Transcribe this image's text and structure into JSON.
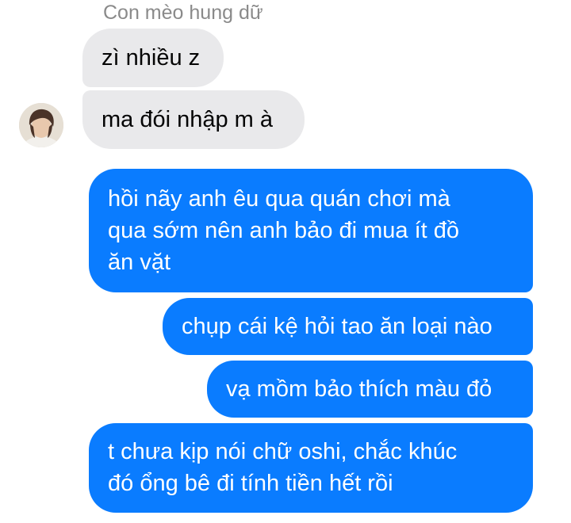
{
  "conversation": {
    "sender_name": "Con mèo hung dữ",
    "avatar_icon": "user-avatar",
    "colors": {
      "incoming_bubble": "#e9e9eb",
      "outgoing_bubble": "#0a7cff",
      "incoming_text": "#050505",
      "outgoing_text": "#ffffff",
      "sender_name_text": "#8a8a8a"
    },
    "messages": [
      {
        "direction": "incoming",
        "lines": [
          "zì nhiều z"
        ]
      },
      {
        "direction": "incoming",
        "lines": [
          "ma đói nhập m à"
        ]
      },
      {
        "direction": "outgoing",
        "lines": [
          "hồi nãy anh êu qua quán chơi mà",
          "qua sớm nên anh bảo đi mua ít đồ",
          "ăn vặt"
        ]
      },
      {
        "direction": "outgoing",
        "lines": [
          "chụp cái kệ hỏi tao ăn loại nào"
        ]
      },
      {
        "direction": "outgoing",
        "lines": [
          "vạ mồm bảo thích màu đỏ"
        ]
      },
      {
        "direction": "outgoing",
        "lines": [
          "t chưa kịp nói chữ oshi, chắc khúc",
          "đó ổng bê đi tính tiền hết rồi"
        ]
      }
    ]
  }
}
